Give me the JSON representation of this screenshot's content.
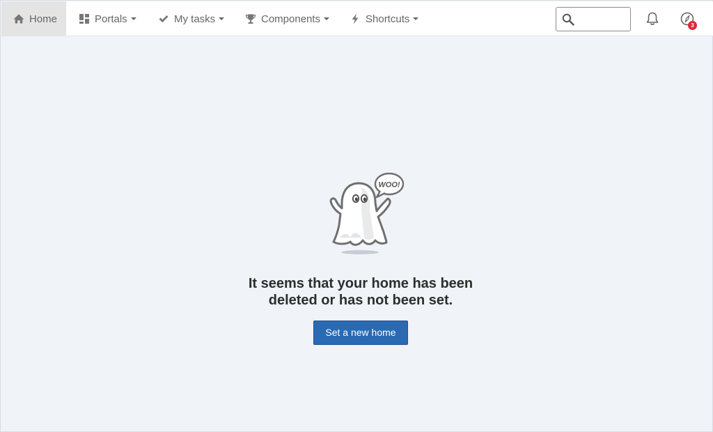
{
  "navbar": {
    "items": [
      {
        "label": "Home",
        "icon": "home-icon",
        "active": true
      },
      {
        "label": "Portals",
        "icon": "dashboard-icon",
        "dropdown": true
      },
      {
        "label": "My tasks",
        "icon": "check-icon",
        "dropdown": true
      },
      {
        "label": "Components",
        "icon": "trophy-icon",
        "dropdown": true
      },
      {
        "label": "Shortcuts",
        "icon": "bolt-icon",
        "dropdown": true
      }
    ],
    "search": {
      "value": "",
      "placeholder": ""
    },
    "notifications_icon": "bell-icon",
    "apps_icon": "compass-icon",
    "apps_badge": "3"
  },
  "main": {
    "illustration": "ghost-icon",
    "illustration_text": "WOO!",
    "message_line1": "It seems that your home has been",
    "message_line2": "deleted or has not been set.",
    "cta_label": "Set a new home"
  },
  "colors": {
    "primary": "#2a6ab3",
    "badge": "#e5243b",
    "background": "#f0f3f8",
    "nav_active": "#e4e4e4"
  }
}
